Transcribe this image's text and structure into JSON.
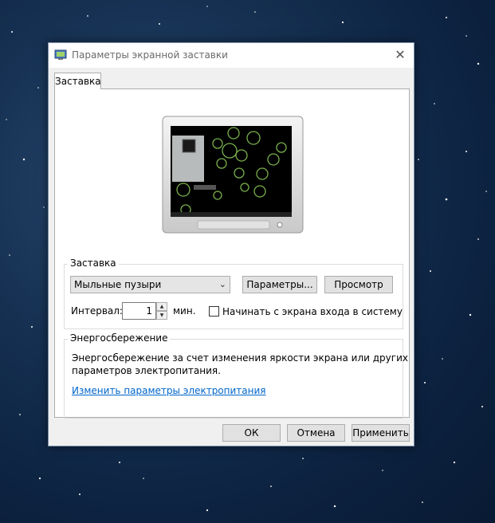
{
  "window": {
    "title": "Параметры экранной заставки",
    "close_glyph": "✕"
  },
  "tabs": [
    {
      "label": "Заставка"
    }
  ],
  "screensaver": {
    "group_label": "Заставка",
    "selected": "Мыльные пузыри",
    "params_button": "Параметры...",
    "preview_button": "Просмотр",
    "interval_label": "Интервал:",
    "interval_value": "1",
    "interval_unit": "мин.",
    "logon_checkbox_label": "Начинать с экрана входа в систему",
    "logon_checked": false
  },
  "power": {
    "group_label": "Энергосбережение",
    "description_line1": "Энергосбережение за счет изменения яркости экрана или других",
    "description_line2": "параметров электропитания.",
    "link": "Изменить параметры электропитания"
  },
  "footer": {
    "ok": "ОК",
    "cancel": "Отмена",
    "apply": "Применить"
  },
  "icons": [
    "display-settings-icon",
    "close-icon",
    "chevron-down-icon",
    "spin-up-icon",
    "spin-down-icon"
  ],
  "colors": {
    "link": "#0066cc",
    "background": "#0c2240"
  }
}
